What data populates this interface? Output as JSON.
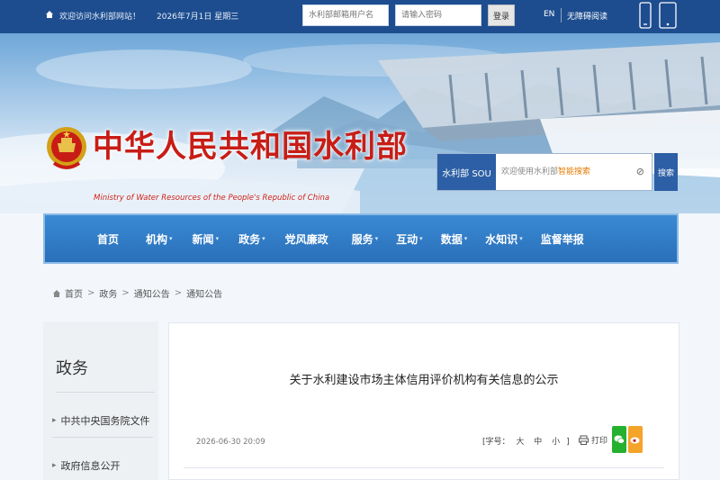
{
  "topbar": {
    "welcome": "欢迎访问水利部网站！",
    "date": "2026年7月1日 星期三",
    "account_placeholder": "水利部邮箱用户名",
    "password_placeholder": "请输入密码",
    "login_label": "登录",
    "lang_label": "EN",
    "access_label": "无障碍阅读",
    "phone_icon": "mobile-phone-icon",
    "tablet_icon": "tablet-icon"
  },
  "banner": {
    "title": "中华人民共和国水利部",
    "subtitle": "Ministry of Water Resources of the People's Republic of China",
    "emblem_icon": "national-emblem-icon"
  },
  "search": {
    "tag_label": "水利部 SOU",
    "placeholder": "欢迎使用水利部",
    "placeholder_hint": "智能搜索",
    "clear_icon": "close-icon",
    "button_label": "搜索"
  },
  "nav": {
    "items": [
      {
        "label": "首页",
        "caret": false
      },
      {
        "label": "机构",
        "caret": true
      },
      {
        "label": "新闻",
        "caret": true
      },
      {
        "label": "政务",
        "caret": true
      },
      {
        "label": "党风廉政",
        "caret": false
      },
      {
        "label": "服务",
        "caret": true
      },
      {
        "label": "互动",
        "caret": true
      },
      {
        "label": "数据",
        "caret": true
      },
      {
        "label": "水知识",
        "caret": true
      },
      {
        "label": "监督举报",
        "caret": false
      }
    ]
  },
  "breadcrumb": {
    "items": [
      "首页",
      "政务",
      "通知公告",
      "通知公告"
    ]
  },
  "sidebar": {
    "heading": "政务",
    "links": [
      "中共中央国务院文件",
      "政府信息公开"
    ]
  },
  "article": {
    "title": "关于水利建设市场主体信用评价机构有关信息的公示",
    "date": "2026-06-30 20:09",
    "font_size_label": "[字号：",
    "font_large": "大",
    "font_medium": "中",
    "font_small": "小",
    "font_size_close": "]",
    "print_label": "打印",
    "share_icons": [
      "wechat-icon",
      "weibo-icon"
    ]
  },
  "colors": {
    "topbar": "#1d4d8f",
    "title_red": "#c81d16",
    "nav_blue": "#2a6fba"
  }
}
